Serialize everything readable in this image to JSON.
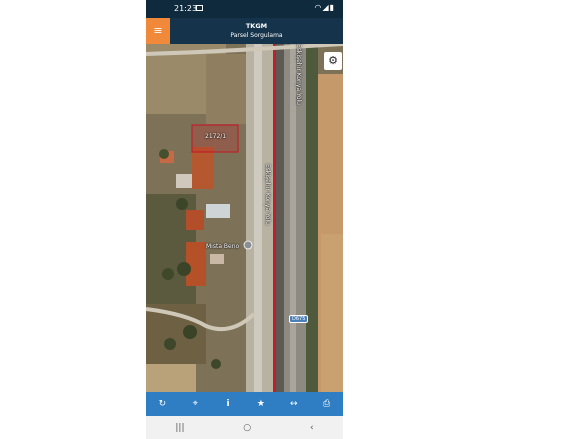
{
  "status_bar": {
    "time": "21:23",
    "icons": [
      "image-icon",
      "wifi-icon",
      "signal-icon",
      "battery-icon"
    ]
  },
  "header": {
    "title": "TKGM",
    "subtitle": "Parsel Sorgulama",
    "menu_icon": "hamburger-menu-icon",
    "brand_color": "#15334a",
    "menu_color": "#f08a3a"
  },
  "map": {
    "parcel_label": "2172/1",
    "road_labels": [
      "Eskişehir Konya Yolu",
      "Eskişehir Konya Yolu"
    ],
    "poi_label": "Mısta Beno",
    "road_shield": "D675",
    "settings_icon": "gear-icon"
  },
  "toolbar": {
    "color": "#2f7dc2",
    "tools": [
      {
        "name": "refresh-icon",
        "glyph": "↻"
      },
      {
        "name": "locate-icon",
        "glyph": "⌖"
      },
      {
        "name": "info-icon",
        "glyph": "i"
      },
      {
        "name": "star-icon",
        "glyph": "★"
      },
      {
        "name": "measure-icon",
        "glyph": "↔"
      },
      {
        "name": "print-icon",
        "glyph": "⎙"
      }
    ]
  },
  "nav_bar": {
    "recent": "|||",
    "home": "○",
    "back": "‹"
  }
}
